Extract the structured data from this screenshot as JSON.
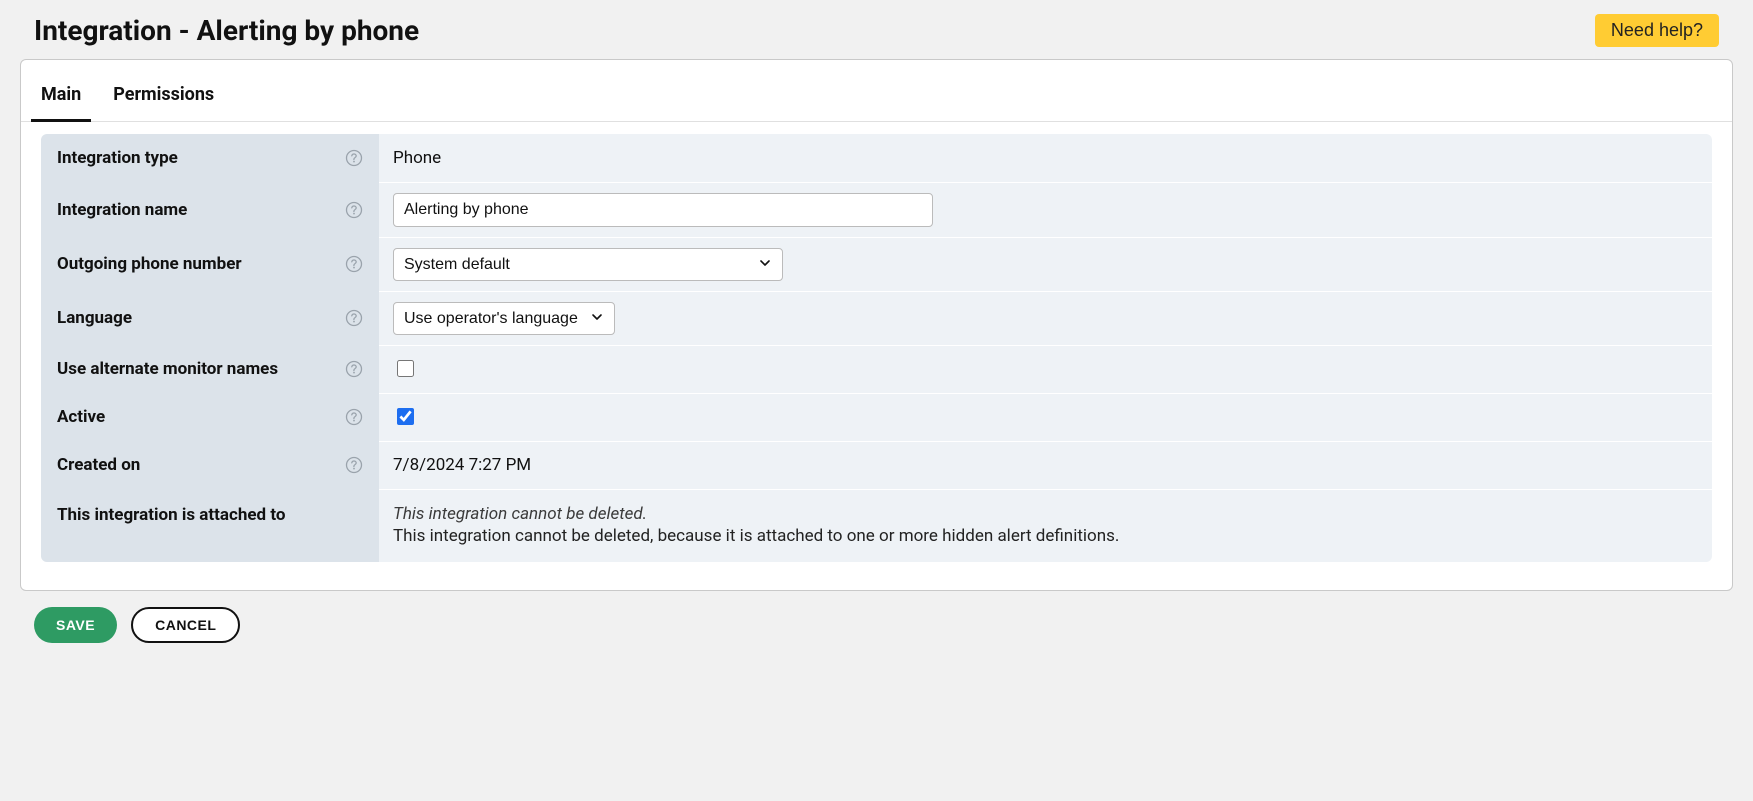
{
  "header": {
    "title": "Integration - Alerting by phone",
    "help_label": "Need help?"
  },
  "tabs": {
    "main": "Main",
    "permissions": "Permissions"
  },
  "form": {
    "integration_type": {
      "label": "Integration type",
      "value": "Phone"
    },
    "integration_name": {
      "label": "Integration name",
      "value": "Alerting by phone"
    },
    "outgoing_phone": {
      "label": "Outgoing phone number",
      "value": "System default"
    },
    "language": {
      "label": "Language",
      "value": "Use operator's language"
    },
    "alt_monitor": {
      "label": "Use alternate monitor names",
      "checked": false
    },
    "active": {
      "label": "Active",
      "checked": true
    },
    "created_on": {
      "label": "Created on",
      "value": "7/8/2024 7:27 PM"
    },
    "attached": {
      "label": "This integration is attached to",
      "note_italic": "This integration cannot be deleted.",
      "note_body": "This integration cannot be deleted, because it is attached to one or more hidden alert definitions."
    }
  },
  "actions": {
    "save": "SAVE",
    "cancel": "CANCEL"
  }
}
